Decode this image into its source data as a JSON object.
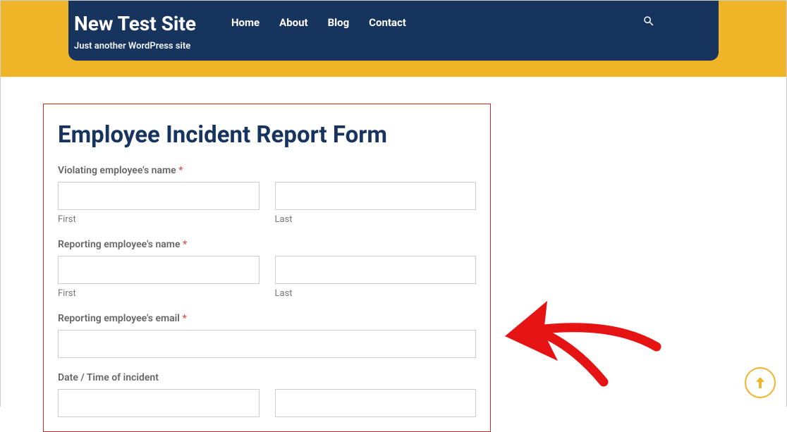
{
  "header": {
    "brand_title": "New Test Site",
    "brand_tagline": "Just another WordPress site",
    "nav": [
      {
        "label": "Home"
      },
      {
        "label": "About"
      },
      {
        "label": "Blog"
      },
      {
        "label": "Contact"
      }
    ]
  },
  "form": {
    "title": "Employee Incident Report Form",
    "fields": {
      "violating_name": {
        "label": "Violating employee's name",
        "required_mark": "*",
        "first_sublabel": "First",
        "last_sublabel": "Last"
      },
      "reporting_name": {
        "label": "Reporting employee's name",
        "required_mark": "*",
        "first_sublabel": "First",
        "last_sublabel": "Last"
      },
      "reporting_email": {
        "label": "Reporting employee's email",
        "required_mark": "*"
      },
      "datetime": {
        "label": "Date / Time of incident"
      }
    }
  }
}
